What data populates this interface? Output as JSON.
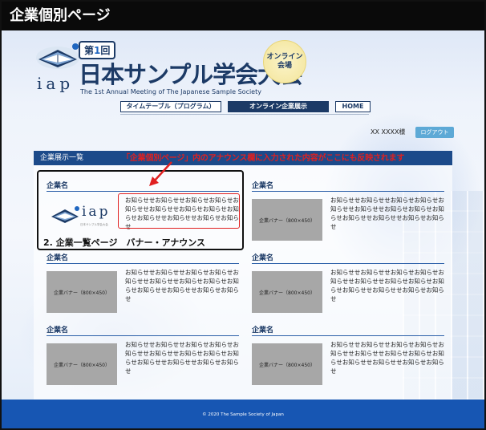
{
  "window": {
    "title": "企業個別ページ"
  },
  "header": {
    "logo_text": "iap",
    "edition_prefix": "第",
    "edition_number": "1",
    "edition_suffix": "回",
    "conference_title": "日本サンプル学会大会",
    "conference_subtitle": "The 1st Annual Meeting of The Japanese Sample Society",
    "badge_line1": "オンライン",
    "badge_line2": "会場"
  },
  "nav": {
    "items": [
      {
        "label": "タイムテーブル（プログラム）",
        "active": false
      },
      {
        "label": "オンライン企業展示",
        "active": true
      },
      {
        "label": "HOME",
        "active": false
      }
    ]
  },
  "user": {
    "name": "XX XXXX様",
    "logout_label": "ログアウト"
  },
  "panel": {
    "title": "企業展示一覧"
  },
  "companies": [
    {
      "name": "企業名",
      "banner": "",
      "banner_logo_text": "iap",
      "banner_logo_sub": "日本サンプル学会大会",
      "text": "お知らせせお知らせせお知らせお知らせお知らせせお知らせせお知らせお知らせお知らせお知らせせお知らせせお知らせお知らせ"
    },
    {
      "name": "企業名",
      "banner": "企業バナー（800×450）",
      "text": "お知らせせお知らせせお知らせお知らせお知らせせお知らせせお知らせお知らせお知らせお知らせせお知らせせお知らせお知らせ"
    },
    {
      "name": "企業名",
      "banner": "企業バナー（800×450）",
      "text": "お知らせせお知らせせお知らせお知らせお知らせせお知らせせお知らせお知らせお知らせお知らせせお知らせせお知らせお知らせ"
    },
    {
      "name": "企業名",
      "banner": "企業バナー（800×450）",
      "text": "お知らせせお知らせせお知らせお知らせお知らせせお知らせせお知らせお知らせお知らせお知らせせお知らせせお知らせお知らせ"
    },
    {
      "name": "企業名",
      "banner": "企業バナー（800×450）",
      "text": "お知らせせお知らせせお知らせお知らせお知らせせお知らせせお知らせお知らせお知らせお知らせせお知らせせお知らせお知らせ"
    },
    {
      "name": "企業名",
      "banner": "企業バナー（800×450）",
      "text": "お知らせせお知らせせお知らせお知らせお知らせせお知らせせお知らせお知らせお知らせお知らせせお知らせせお知らせお知らせ"
    }
  ],
  "annotations": {
    "red_note": "「企業個別ページ」内のアナウンス欄に入力された内容がここにも反映されます",
    "black_label": "2. 企業一覧ページ　バナー・アナウンス"
  },
  "footer": {
    "copyright": "© 2020 The Sample Society of Japan"
  },
  "colors": {
    "navy": "#1c3a66",
    "accent_blue": "#1756b3",
    "annotation_red": "#e02020",
    "logout": "#5da9d6"
  }
}
